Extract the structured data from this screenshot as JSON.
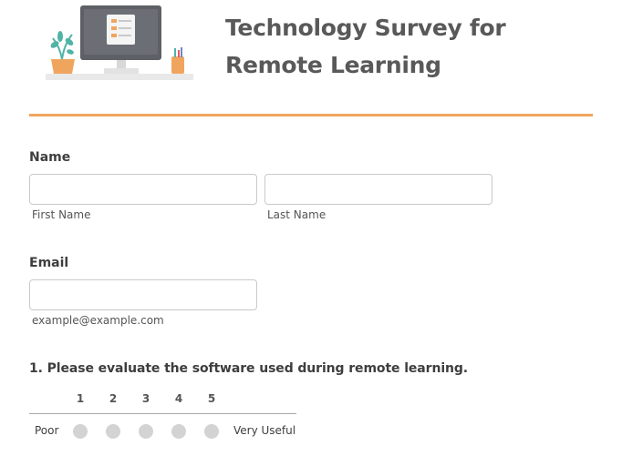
{
  "header": {
    "title": "Technology Survey for Remote Learning",
    "accent_color": "#f0a55e",
    "illustration_icon": "computer-desk-illustration"
  },
  "name_field": {
    "label": "Name",
    "first_value": "",
    "first_sublabel": "First Name",
    "last_value": "",
    "last_sublabel": "Last Name"
  },
  "email_field": {
    "label": "Email",
    "value": "",
    "sublabel": "example@example.com"
  },
  "question1": {
    "label": "1. Please evaluate the software used during remote learning.",
    "scale": [
      "1",
      "2",
      "3",
      "4",
      "5"
    ],
    "low_label": "Poor",
    "high_label": "Very Useful",
    "selected": null
  }
}
